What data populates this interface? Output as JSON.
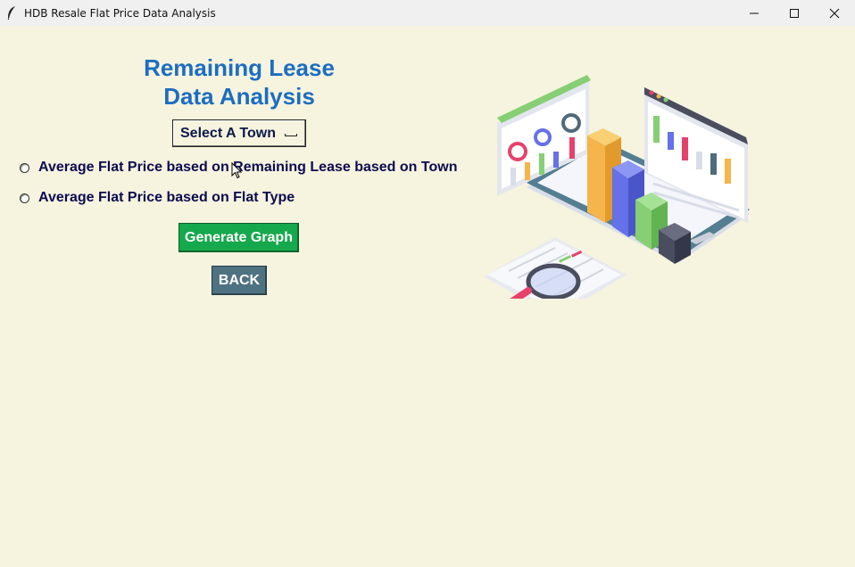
{
  "window": {
    "title": "HDB Resale Flat Price Data Analysis"
  },
  "heading": {
    "line1": "Remaining Lease",
    "line2": "Data Analysis"
  },
  "town_select": {
    "label": "Select A Town"
  },
  "options": [
    {
      "label": "Average Flat Price based on Remaining Lease based on Town"
    },
    {
      "label": "Average Flat Price based on Flat Type"
    }
  ],
  "buttons": {
    "generate": "Generate Graph",
    "back": "BACK"
  },
  "colors": {
    "background": "#f6f3de",
    "heading": "#1c6ec0",
    "generate_button": "#16a84c",
    "back_button": "#4f7282",
    "option_text": "#0b0b50"
  },
  "icons": {
    "app": "feather-icon",
    "minimize": "minimize-icon",
    "maximize": "maximize-icon",
    "close": "close-icon",
    "illustration": "data-analysis-illustration"
  }
}
